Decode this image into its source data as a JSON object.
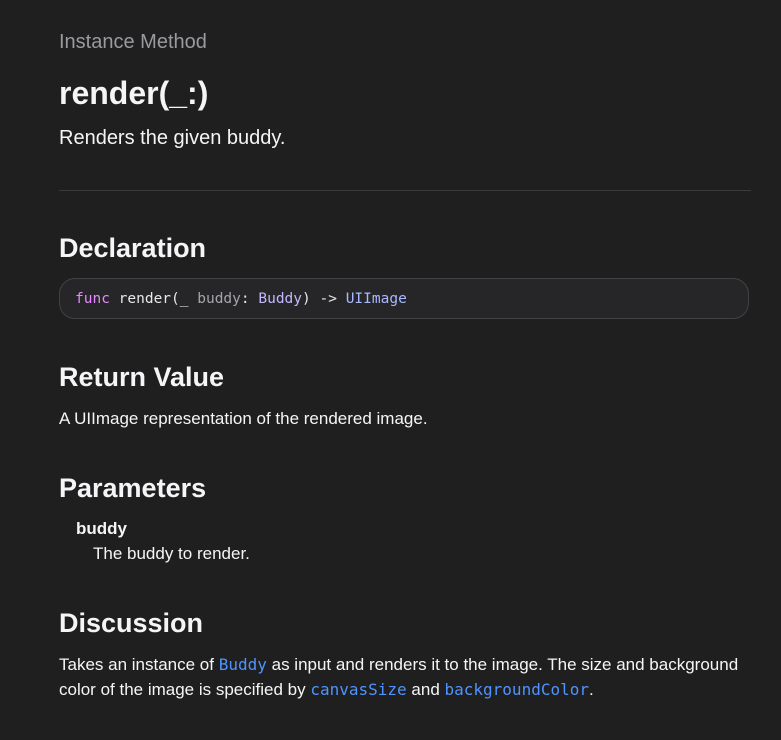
{
  "header": {
    "eyebrow": "Instance Method",
    "title": "render(_:)",
    "abstract": "Renders the given buddy."
  },
  "declaration": {
    "heading": "Declaration",
    "code": {
      "keyword": "func",
      "name": "render(",
      "underscore": "_",
      "param_name": "buddy",
      "colon": ":",
      "param_type": "Buddy",
      "close": ")",
      "arrow": "->",
      "return_type": "UIImage"
    }
  },
  "return_value": {
    "heading": "Return Value",
    "text": "A UIImage representation of the rendered image."
  },
  "parameters": {
    "heading": "Parameters",
    "items": [
      {
        "name": "buddy",
        "description": "The buddy to render."
      }
    ]
  },
  "discussion": {
    "heading": "Discussion",
    "text_before_link1": "Takes an instance of ",
    "link1": "Buddy",
    "text_between1": " as input and renders it to the image. The size and background color of the image is specified by ",
    "link2": "canvasSize",
    "text_between2": " and ",
    "link3": "backgroundColor",
    "text_after": "."
  },
  "colors": {
    "background": "#1f1f1f",
    "text": "#f5f5f7",
    "eyebrow": "#9a9a9f",
    "link": "#4f93ff",
    "keyword": "#e688ff",
    "type": "#c3b8ff"
  }
}
